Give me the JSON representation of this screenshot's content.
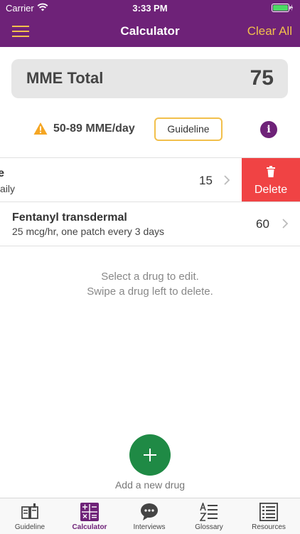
{
  "status": {
    "carrier": "Carrier",
    "time": "3:33 PM"
  },
  "nav": {
    "title": "Calculator",
    "clear_label": "Clear All"
  },
  "total": {
    "label": "MME Total",
    "value": "75"
  },
  "warning": {
    "range": "50-89 MME/day",
    "guideline_label": "Guideline",
    "info_label": "i"
  },
  "drugs": [
    {
      "name": "odone",
      "detail": "ablet daily",
      "mme": "15"
    },
    {
      "name": "Fentanyl transdermal",
      "detail": "25 mcg/hr, one patch every 3 days",
      "mme": "60"
    }
  ],
  "delete_label": "Delete",
  "hints": {
    "line1": "Select a drug to edit.",
    "line2": "Swipe a drug left to delete."
  },
  "add_label": "Add a new drug",
  "tabs": [
    {
      "label": "Guideline",
      "icon": "book-icon"
    },
    {
      "label": "Calculator",
      "icon": "calculator-icon",
      "active": true
    },
    {
      "label": "Interviews",
      "icon": "chat-bubble-icon"
    },
    {
      "label": "Glossary",
      "icon": "sort-az-icon"
    },
    {
      "label": "Resources",
      "icon": "list-icon"
    }
  ],
  "colors": {
    "brand": "#6e2278",
    "accent": "#f2c04c",
    "delete": "#f04344",
    "add": "#1f8a45",
    "warning": "#f5a623"
  }
}
